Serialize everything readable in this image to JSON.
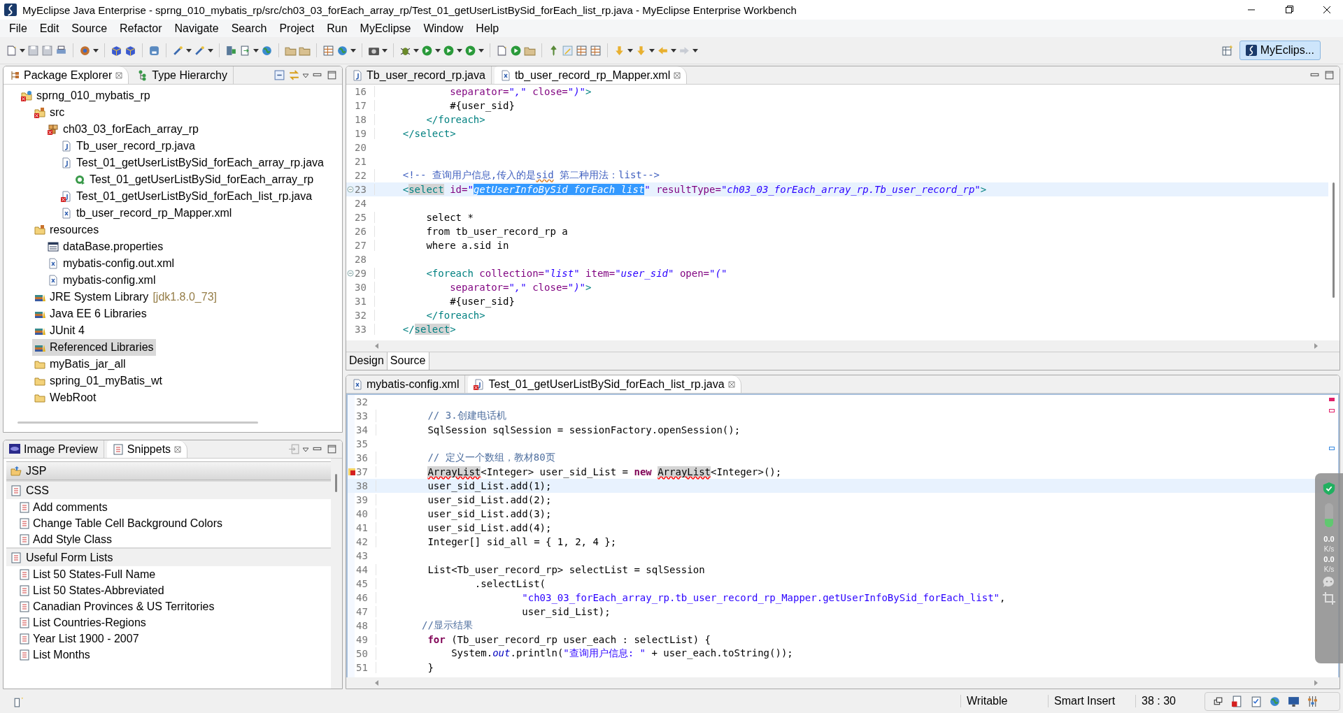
{
  "window": {
    "title": "MyEclipse Java Enterprise - sprng_010_mybatis_rp/src/ch03_03_forEach_array_rp/Test_01_getUserListBySid_forEach_list_rp.java - MyEclipse Enterprise Workbench"
  },
  "menu": [
    "File",
    "Edit",
    "Source",
    "Refactor",
    "Navigate",
    "Search",
    "Project",
    "Run",
    "MyEclipse",
    "Window",
    "Help"
  ],
  "perspective": {
    "label": "MyEclips...",
    "selected": true
  },
  "explorer": {
    "tabs": [
      {
        "label": "Package Explorer",
        "selected": true
      },
      {
        "label": "Type Hierarchy",
        "selected": false
      }
    ],
    "tree": [
      {
        "label": "sprng_010_mybatis_rp",
        "kind": "project",
        "error": true,
        "selected": false,
        "children": [
          {
            "label": "src",
            "kind": "source-folder",
            "error": true,
            "selected": false,
            "children": [
              {
                "label": "ch03_03_forEach_array_rp",
                "kind": "package",
                "error": true,
                "selected": false,
                "children": [
                  {
                    "label": "Tb_user_record_rp.java",
                    "kind": "java",
                    "error": false,
                    "selected": false
                  },
                  {
                    "label": "Test_01_getUserListBySid_forEach_array_rp.java",
                    "kind": "java",
                    "error": false,
                    "selected": false,
                    "children": [
                      {
                        "label": "Test_01_getUserListBySid_forEach_array_rp",
                        "kind": "class",
                        "error": false,
                        "selected": false
                      }
                    ]
                  },
                  {
                    "label": "Test_01_getUserListBySid_forEach_list_rp.java",
                    "kind": "java",
                    "error": true,
                    "selected": false
                  },
                  {
                    "label": "tb_user_record_rp_Mapper.xml",
                    "kind": "xml",
                    "error": false,
                    "selected": false
                  }
                ]
              }
            ]
          },
          {
            "label": "resources",
            "kind": "source-folder",
            "error": false,
            "selected": false,
            "children": [
              {
                "label": "dataBase.properties",
                "kind": "properties",
                "error": false,
                "selected": false
              },
              {
                "label": "mybatis-config.out.xml",
                "kind": "xml",
                "error": false,
                "selected": false
              },
              {
                "label": "mybatis-config.xml",
                "kind": "xml",
                "error": false,
                "selected": false
              }
            ]
          },
          {
            "label": "JRE System Library",
            "decoration": "[jdk1.8.0_73]",
            "kind": "library",
            "error": false,
            "selected": false
          },
          {
            "label": "Java EE 6 Libraries",
            "kind": "library",
            "error": false,
            "selected": false
          },
          {
            "label": "JUnit 4",
            "kind": "library",
            "error": false,
            "selected": false
          },
          {
            "label": "Referenced Libraries",
            "kind": "library",
            "error": false,
            "selected": true
          },
          {
            "label": "myBatis_jar_all",
            "kind": "folder",
            "error": false,
            "selected": false
          },
          {
            "label": "spring_01_myBatis_wt",
            "kind": "folder",
            "error": false,
            "selected": false
          },
          {
            "label": "WebRoot",
            "kind": "folder",
            "error": false,
            "selected": false
          }
        ]
      }
    ]
  },
  "snippets": {
    "tabs": [
      {
        "label": "Image Preview",
        "selected": false
      },
      {
        "label": "Snippets",
        "selected": true
      }
    ],
    "drawers": [
      {
        "label": "JSP",
        "selected": true
      },
      {
        "label": "CSS",
        "selected": false,
        "items": [
          "Add comments",
          "Change Table Cell Background Colors",
          "Add Style Class"
        ]
      },
      {
        "label": "Useful Form Lists",
        "selected": false,
        "items": [
          "List 50 States-Full Name",
          "List 50 States-Abbreviated",
          "Canadian Provinces & US Territories",
          "List Countries-Regions",
          "Year List 1900 - 2007",
          "List Months"
        ]
      }
    ]
  },
  "top_editor": {
    "tabs": [
      {
        "label": "Tb_user_record_rp.java",
        "kind": "java",
        "error": false,
        "selected": false
      },
      {
        "label": "tb_user_record_rp_Mapper.xml",
        "kind": "xml",
        "error": false,
        "selected": true
      }
    ],
    "lines": [
      {
        "num": "16",
        "kind": "plain",
        "current": false,
        "tokens": [
          {
            "kind": "attr",
            "text": "            separator="
          },
          {
            "kind": "value",
            "text": "\",\""
          },
          {
            "kind": "attr",
            "text": " close="
          },
          {
            "kind": "value",
            "text": "\")\""
          },
          {
            "kind": "tag",
            "text": ">"
          }
        ]
      },
      {
        "num": "17",
        "kind": "plain",
        "current": false,
        "tokens": [
          {
            "kind": "text",
            "text": "            #{user_sid}"
          }
        ]
      },
      {
        "num": "18",
        "kind": "plain",
        "current": false,
        "tokens": [
          {
            "kind": "tag",
            "text": "        </foreach>"
          }
        ]
      },
      {
        "num": "19",
        "kind": "plain",
        "current": false,
        "tokens": [
          {
            "kind": "tag",
            "text": "    </select>"
          }
        ]
      },
      {
        "num": "20",
        "kind": "plain",
        "current": false
      },
      {
        "num": "21",
        "kind": "plain",
        "current": false
      },
      {
        "num": "22",
        "kind": "plain",
        "current": false,
        "tokens": [
          {
            "kind": "comment",
            "text": "    <!-- 查询用户信息,传入的是"
          },
          {
            "kind": "comment-misspelled",
            "text": "sid"
          },
          {
            "kind": "comment",
            "text": " 第二种用法：list-->"
          }
        ]
      },
      {
        "num": "23",
        "kind": "fold",
        "current": true,
        "tokens": [
          {
            "kind": "tag",
            "text": "    <"
          },
          {
            "kind": "tag-occurrence",
            "text": "select"
          },
          {
            "kind": "attr",
            "text": " id="
          },
          {
            "kind": "value",
            "text": "\""
          },
          {
            "kind": "value-selected",
            "text": "getUserInfoBySid_forEach_list"
          },
          {
            "kind": "value",
            "text": "\""
          },
          {
            "kind": "attr",
            "text": " resultType="
          },
          {
            "kind": "value",
            "text": "\"ch03_03_forEach_array_rp.Tb_user_record_rp\""
          },
          {
            "kind": "tag",
            "text": ">"
          }
        ]
      },
      {
        "num": "24",
        "kind": "plain",
        "current": false
      },
      {
        "num": "25",
        "kind": "plain",
        "current": false,
        "tokens": [
          {
            "kind": "text",
            "text": "        select *"
          }
        ]
      },
      {
        "num": "26",
        "kind": "plain",
        "current": false,
        "tokens": [
          {
            "kind": "text",
            "text": "        from tb_user_record_rp a"
          }
        ]
      },
      {
        "num": "27",
        "kind": "plain",
        "current": false,
        "tokens": [
          {
            "kind": "text",
            "text": "        where a.sid in"
          }
        ]
      },
      {
        "num": "28",
        "kind": "plain",
        "current": false
      },
      {
        "num": "29",
        "kind": "fold",
        "current": false,
        "tokens": [
          {
            "kind": "tag",
            "text": "        <foreach"
          },
          {
            "kind": "attr",
            "text": " collection="
          },
          {
            "kind": "value",
            "text": "\"list\""
          },
          {
            "kind": "attr",
            "text": " item="
          },
          {
            "kind": "value",
            "text": "\"user_sid\""
          },
          {
            "kind": "attr",
            "text": " open="
          },
          {
            "kind": "value",
            "text": "\"(\""
          }
        ]
      },
      {
        "num": "30",
        "kind": "plain",
        "current": false,
        "tokens": [
          {
            "kind": "attr",
            "text": "            separator="
          },
          {
            "kind": "value",
            "text": "\",\""
          },
          {
            "kind": "attr",
            "text": " close="
          },
          {
            "kind": "value",
            "text": "\")\""
          },
          {
            "kind": "tag",
            "text": ">"
          }
        ]
      },
      {
        "num": "31",
        "kind": "plain",
        "current": false,
        "tokens": [
          {
            "kind": "text",
            "text": "            #{user_sid}"
          }
        ]
      },
      {
        "num": "32",
        "kind": "plain",
        "current": false,
        "tokens": [
          {
            "kind": "tag",
            "text": "        </foreach>"
          }
        ]
      },
      {
        "num": "33",
        "kind": "plain",
        "current": false,
        "tokens": [
          {
            "kind": "tag",
            "text": "    </"
          },
          {
            "kind": "tag-occurrence",
            "text": "select"
          },
          {
            "kind": "tag",
            "text": ">"
          }
        ]
      }
    ],
    "view_tabs": [
      {
        "label": "Design",
        "selected": false
      },
      {
        "label": "Source",
        "selected": true
      }
    ]
  },
  "bottom_editor": {
    "tabs": [
      {
        "label": "mybatis-config.xml",
        "kind": "xml",
        "error": false,
        "selected": false
      },
      {
        "label": "Test_01_getUserListBySid_forEach_list_rp.java",
        "kind": "java",
        "error": true,
        "selected": true
      }
    ],
    "lines": [
      {
        "num": "32",
        "kind": "plain",
        "current": false
      },
      {
        "num": "33",
        "kind": "plain",
        "current": false,
        "tokens": [
          {
            "kind": "jcomment",
            "text": "        // 3.创建电话机"
          }
        ]
      },
      {
        "num": "34",
        "kind": "plain",
        "current": false,
        "tokens": [
          {
            "kind": "text",
            "text": "        SqlSession sqlSession = sessionFactory.openSession();"
          }
        ]
      },
      {
        "num": "35",
        "kind": "plain",
        "current": false
      },
      {
        "num": "36",
        "kind": "plain",
        "current": false,
        "tokens": [
          {
            "kind": "jcomment",
            "text": "        // 定义一个数组，教材80页"
          }
        ]
      },
      {
        "num": "37",
        "kind": "error",
        "current": false,
        "tokens": [
          {
            "kind": "text-error",
            "text": "        ArrayList"
          },
          {
            "kind": "text",
            "text": "<Integer> user_sid_List = "
          },
          {
            "kind": "keyword",
            "text": "new "
          },
          {
            "kind": "text-error",
            "text": "ArrayList"
          },
          {
            "kind": "text",
            "text": "<Integer>();"
          }
        ]
      },
      {
        "num": "38",
        "kind": "plain",
        "current": true,
        "tokens": [
          {
            "kind": "text",
            "text": "        user_sid_List.add(1);"
          }
        ]
      },
      {
        "num": "39",
        "kind": "plain",
        "current": false,
        "tokens": [
          {
            "kind": "text",
            "text": "        user_sid_List.add(2);"
          }
        ]
      },
      {
        "num": "40",
        "kind": "plain",
        "current": false,
        "tokens": [
          {
            "kind": "text",
            "text": "        user_sid_List.add(3);"
          }
        ]
      },
      {
        "num": "41",
        "kind": "plain",
        "current": false,
        "tokens": [
          {
            "kind": "text",
            "text": "        user_sid_List.add(4);"
          }
        ]
      },
      {
        "num": "42",
        "kind": "plain",
        "current": false,
        "tokens": [
          {
            "kind": "text",
            "text": "        Integer[] sid_all = { 1, 2, 4 };"
          }
        ]
      },
      {
        "num": "43",
        "kind": "plain",
        "current": false
      },
      {
        "num": "44",
        "kind": "plain",
        "current": false,
        "tokens": [
          {
            "kind": "text",
            "text": "        List<Tb_user_record_rp> selectList = sqlSession"
          }
        ]
      },
      {
        "num": "45",
        "kind": "plain",
        "current": false,
        "tokens": [
          {
            "kind": "text",
            "text": "                .selectList("
          }
        ]
      },
      {
        "num": "46",
        "kind": "plain",
        "current": false,
        "tokens": [
          {
            "kind": "string",
            "text": "                        \"ch03_03_forEach_array_rp.tb_user_record_rp_Mapper.getUserInfoBySid_forEach_list\""
          },
          {
            "kind": "text",
            "text": ","
          }
        ]
      },
      {
        "num": "47",
        "kind": "plain",
        "current": false,
        "tokens": [
          {
            "kind": "text",
            "text": "                        user_sid_List);"
          }
        ]
      },
      {
        "num": "48",
        "kind": "plain",
        "current": false,
        "tokens": [
          {
            "kind": "jcomment",
            "text": "       //显示结果"
          }
        ]
      },
      {
        "num": "49",
        "kind": "plain",
        "current": false,
        "tokens": [
          {
            "kind": "keyword",
            "text": "        for"
          },
          {
            "kind": "text",
            "text": " (Tb_user_record_rp user_each : selectList) {"
          }
        ]
      },
      {
        "num": "50",
        "kind": "plain",
        "current": false,
        "tokens": [
          {
            "kind": "text",
            "text": "            System."
          },
          {
            "kind": "static",
            "text": "out"
          },
          {
            "kind": "text",
            "text": ".println("
          },
          {
            "kind": "string",
            "text": "\"查询用户信息: \""
          },
          {
            "kind": "text",
            "text": " + user_each.toString());"
          }
        ]
      },
      {
        "num": "51",
        "kind": "plain",
        "current": false,
        "tokens": [
          {
            "kind": "text",
            "text": "        }"
          }
        ]
      }
    ]
  },
  "status_bar": {
    "mode": "Writable",
    "insert": "Smart Insert",
    "position": "38 : 30"
  },
  "net_monitor": {
    "upload": "0.0",
    "upload_unit": "K/s",
    "download": "0.0",
    "download_unit": "K/s"
  }
}
